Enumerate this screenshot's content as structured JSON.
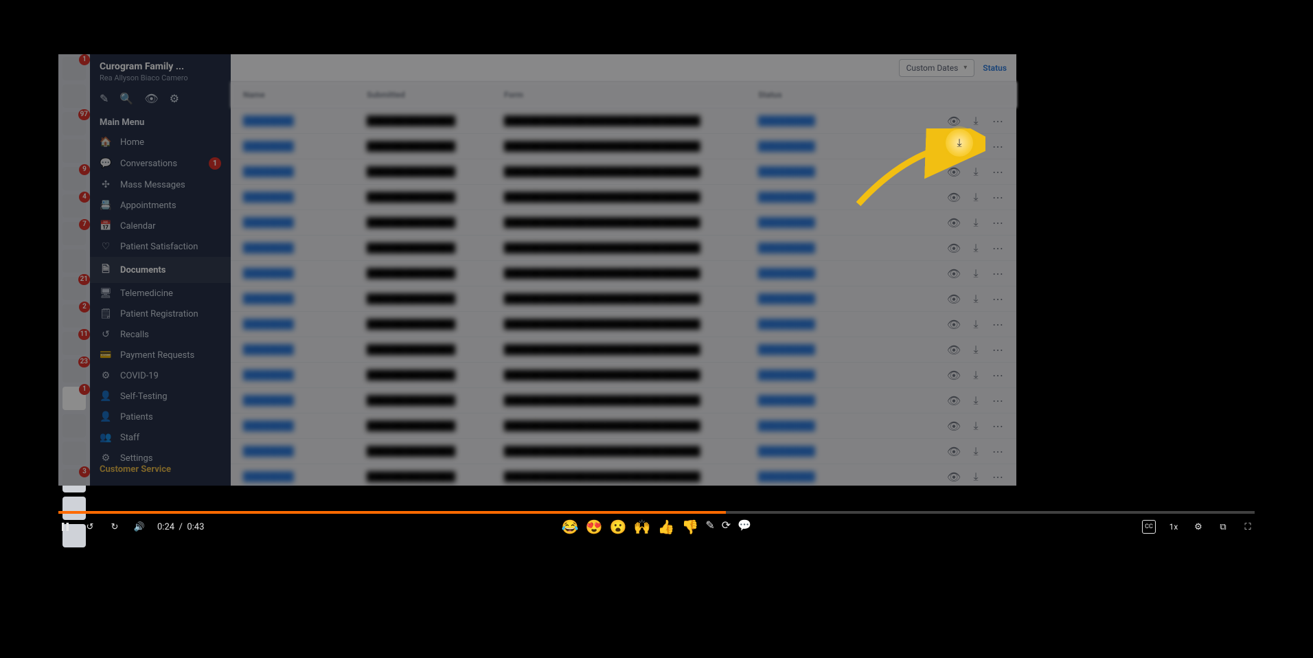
{
  "sidebar": {
    "title": "Curogram Family ...",
    "subtitle": "Rea Allyson Biaco Camero",
    "section_label": "Main Menu",
    "footer": "Customer Service",
    "items": [
      {
        "icon": "🏠",
        "label": "Home"
      },
      {
        "icon": "💬",
        "label": "Conversations",
        "badge": "1"
      },
      {
        "icon": "✣",
        "label": "Mass Messages"
      },
      {
        "icon": "📇",
        "label": "Appointments"
      },
      {
        "icon": "📅",
        "label": "Calendar"
      },
      {
        "icon": "♡",
        "label": "Patient Satisfaction"
      },
      {
        "icon": "🗎",
        "label": "Documents",
        "active": true
      },
      {
        "icon": "🖥",
        "label": "Telemedicine"
      },
      {
        "icon": "🗒",
        "label": "Patient Registration"
      },
      {
        "icon": "↺",
        "label": "Recalls"
      },
      {
        "icon": "💳",
        "label": "Payment Requests"
      },
      {
        "icon": "⚙",
        "label": "COVID-19"
      },
      {
        "icon": "👤",
        "label": "Self-Testing"
      },
      {
        "icon": "👤",
        "label": "Patients"
      },
      {
        "icon": "👥",
        "label": "Staff"
      },
      {
        "icon": "⚙",
        "label": "Settings"
      }
    ]
  },
  "rail_badges": [
    "1",
    "",
    "97",
    "",
    "9",
    "4",
    "7",
    "",
    "21",
    "2",
    "11",
    "23",
    "1",
    "",
    "",
    "3",
    "",
    ""
  ],
  "toolbar": {
    "custom_dates": "Custom Dates",
    "status": "Status"
  },
  "table": {
    "headers": {
      "name": "Name",
      "date": "Submitted",
      "form": "Form",
      "status": "Status"
    },
    "row_count": 15
  },
  "player": {
    "current": "0:24",
    "duration": "0:43",
    "speed": "1x",
    "reactions": [
      "😂",
      "😍",
      "😮",
      "🙌",
      "👍",
      "👎"
    ]
  }
}
